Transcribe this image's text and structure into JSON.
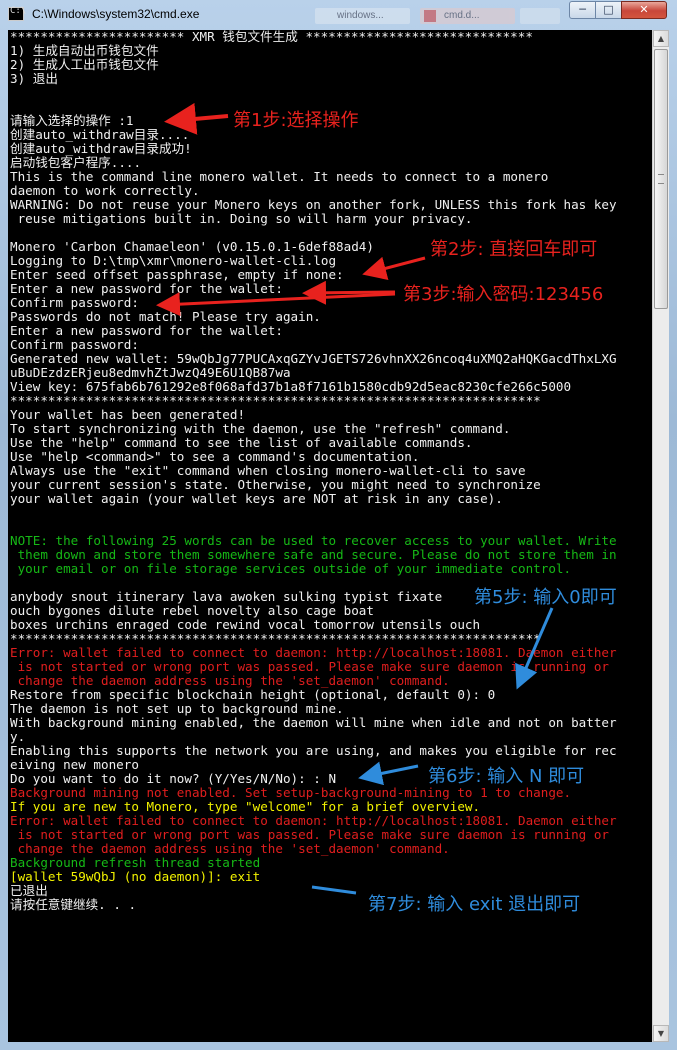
{
  "window": {
    "title": "C:\\Windows\\system32\\cmd.exe",
    "background_tab_1": "windows...",
    "background_tab_2": "cmd.d..."
  },
  "controls": {
    "minimize": "─",
    "maximize": "□",
    "close": "✕"
  },
  "console": {
    "lines": [
      {
        "text": "*********************** XMR 钱包文件生成 ******************************",
        "color": "white"
      },
      {
        "text": "1) 生成自动出币钱包文件",
        "color": "white"
      },
      {
        "text": "2) 生成人工出币钱包文件",
        "color": "white"
      },
      {
        "text": "3) 退出",
        "color": "white"
      },
      {
        "text": "",
        "color": "white"
      },
      {
        "text": "",
        "color": "white"
      },
      {
        "text": "请输入选择的操作 :1",
        "color": "white"
      },
      {
        "text": "创建auto_withdraw目录....",
        "color": "white"
      },
      {
        "text": "创建auto_withdraw目录成功!",
        "color": "white"
      },
      {
        "text": "启动钱包客户程序....",
        "color": "white"
      },
      {
        "text": "This is the command line monero wallet. It needs to connect to a monero",
        "color": "white"
      },
      {
        "text": "daemon to work correctly.",
        "color": "white"
      },
      {
        "text": "WARNING: Do not reuse your Monero keys on another fork, UNLESS this fork has key",
        "color": "white"
      },
      {
        "text": " reuse mitigations built in. Doing so will harm your privacy.",
        "color": "white"
      },
      {
        "text": "",
        "color": "white"
      },
      {
        "text": "Monero 'Carbon Chamaeleon' (v0.15.0.1-6def88ad4)",
        "color": "white"
      },
      {
        "text": "Logging to D:\\tmp\\xmr\\monero-wallet-cli.log",
        "color": "white"
      },
      {
        "text": "Enter seed offset passphrase, empty if none:",
        "color": "white"
      },
      {
        "text": "Enter a new password for the wallet:",
        "color": "white"
      },
      {
        "text": "Confirm password:",
        "color": "white"
      },
      {
        "text": "Passwords do not match! Please try again.",
        "color": "white"
      },
      {
        "text": "Enter a new password for the wallet:",
        "color": "white"
      },
      {
        "text": "Confirm password:",
        "color": "white"
      },
      {
        "text": "Generated new wallet: 59wQbJg77PUCAxqGZYvJGETS726vhnXX26ncoq4uXMQ2aHQKGacdThxLXG",
        "color": "white"
      },
      {
        "text": "uBuDEzdzERjeu8edmvhZtJwzQ49E6U1QB87wa",
        "color": "white"
      },
      {
        "text": "View key: 675fab6b761292e8f068afd37b1a8f7161b1580cdb92d5eac8230cfe266c5000",
        "color": "white"
      },
      {
        "text": "**********************************************************************",
        "color": "white"
      },
      {
        "text": "Your wallet has been generated!",
        "color": "white"
      },
      {
        "text": "To start synchronizing with the daemon, use the \"refresh\" command.",
        "color": "white"
      },
      {
        "text": "Use the \"help\" command to see the list of available commands.",
        "color": "white"
      },
      {
        "text": "Use \"help <command>\" to see a command's documentation.",
        "color": "white"
      },
      {
        "text": "Always use the \"exit\" command when closing monero-wallet-cli to save",
        "color": "white"
      },
      {
        "text": "your current session's state. Otherwise, you might need to synchronize",
        "color": "white"
      },
      {
        "text": "your wallet again (your wallet keys are NOT at risk in any case).",
        "color": "white"
      },
      {
        "text": "",
        "color": "white"
      },
      {
        "text": "",
        "color": "white"
      },
      {
        "text": "NOTE: the following 25 words can be used to recover access to your wallet. Write",
        "color": "green"
      },
      {
        "text": " them down and store them somewhere safe and secure. Please do not store them in",
        "color": "green"
      },
      {
        "text": " your email or on file storage services outside of your immediate control.",
        "color": "green"
      },
      {
        "text": "",
        "color": "white"
      },
      {
        "text": "anybody snout itinerary lava awoken sulking typist fixate",
        "color": "white"
      },
      {
        "text": "ouch bygones dilute rebel novelty also cage boat",
        "color": "white"
      },
      {
        "text": "boxes urchins enraged code rewind vocal tomorrow utensils ouch",
        "color": "white"
      },
      {
        "text": "**********************************************************************",
        "color": "white"
      },
      {
        "text": "Error: wallet failed to connect to daemon: http://localhost:18081. Daemon either",
        "color": "red"
      },
      {
        "text": " is not started or wrong port was passed. Please make sure daemon is running or",
        "color": "red"
      },
      {
        "text": " change the daemon address using the 'set_daemon' command.",
        "color": "red"
      },
      {
        "text": "Restore from specific blockchain height (optional, default 0): 0",
        "color": "white"
      },
      {
        "text": "The daemon is not set up to background mine.",
        "color": "white"
      },
      {
        "text": "With background mining enabled, the daemon will mine when idle and not on batter",
        "color": "white"
      },
      {
        "text": "y.",
        "color": "white"
      },
      {
        "text": "Enabling this supports the network you are using, and makes you eligible for rec",
        "color": "white"
      },
      {
        "text": "eiving new monero",
        "color": "white"
      },
      {
        "text": "Do you want to do it now? (Y/Yes/N/No): : N",
        "color": "white"
      },
      {
        "text": "Background mining not enabled. Set setup-background-mining to 1 to change.",
        "color": "red"
      },
      {
        "text": "If you are new to Monero, type \"welcome\" for a brief overview.",
        "color": "yellow"
      },
      {
        "text": "Error: wallet failed to connect to daemon: http://localhost:18081. Daemon either",
        "color": "red"
      },
      {
        "text": " is not started or wrong port was passed. Please make sure daemon is running or",
        "color": "red"
      },
      {
        "text": " change the daemon address using the 'set_daemon' command.",
        "color": "red"
      },
      {
        "text": "Background refresh thread started",
        "color": "green"
      },
      {
        "text": "[wallet 59wQbJ (no daemon)]: exit",
        "color": "yellow"
      },
      {
        "text": "已退出",
        "color": "white"
      },
      {
        "text": "请按任意键继续. . .",
        "color": "white"
      }
    ]
  },
  "annotations": {
    "step1": "第1步:选择操作",
    "step2": "第2步: 直接回车即可",
    "step3": "第3步:输入密码:123456",
    "step5": "第5步: 输入0即可",
    "step6": "第6步: 输入 N 即可",
    "step7": "第7步: 输入  exit   退出即可",
    "red_color": "#e8221e",
    "blue_color": "#2f8cdc"
  },
  "icons": {
    "console_icon": "cmd-icon",
    "scroll_up": "up-arrow-icon",
    "scroll_down": "down-arrow-icon"
  }
}
